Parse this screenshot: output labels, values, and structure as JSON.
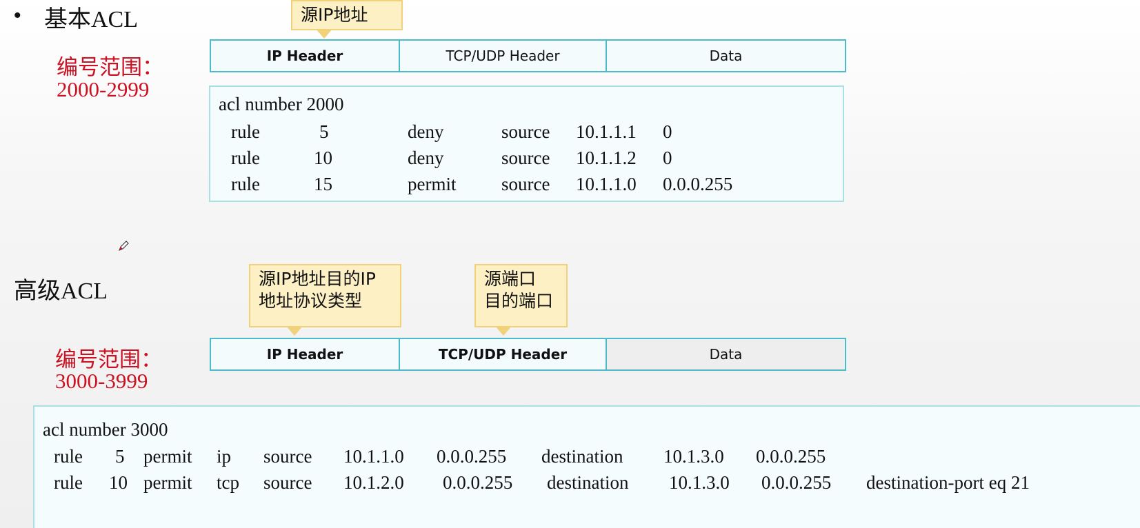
{
  "basic": {
    "bullet": "•",
    "title": "基本ACL",
    "range_label": "编号范围：",
    "range_value": "2000-2999",
    "callout": "源IP地址",
    "header_cells": [
      "IP Header",
      "TCP/UDP Header",
      "Data"
    ],
    "code_title": "acl number 2000",
    "rules": [
      [
        "rule",
        "5",
        "deny",
        "source",
        "10.1.1.1",
        "0"
      ],
      [
        "rule",
        "10",
        "deny",
        "source",
        "10.1.1.2",
        "0"
      ],
      [
        "rule",
        "15",
        "permit",
        "source",
        "10.1.1.0",
        "0.0.0.255"
      ]
    ]
  },
  "advanced": {
    "title": "高级ACL",
    "range_label": "编号范围：",
    "range_value": "3000-3999",
    "callout_ip_line1": "源IP地址目的IP",
    "callout_ip_line2": "地址协议类型",
    "callout_port_line1": "源端口",
    "callout_port_line2": "目的端口",
    "header_cells": [
      "IP Header",
      "TCP/UDP Header",
      "Data"
    ],
    "code_title": "acl number 3000",
    "rules": [
      [
        "rule",
        "5",
        "permit",
        "ip",
        "source",
        "10.1.1.0",
        "0.0.0.255",
        "destination",
        "10.1.3.0",
        "0.0.0.255",
        ""
      ],
      [
        "rule",
        "10",
        "permit",
        "tcp",
        "source",
        "10.1.2.0",
        "0.0.0.255",
        "destination",
        "10.1.3.0",
        "0.0.0.255",
        "destination-port eq 21"
      ]
    ]
  },
  "icons": {
    "cursor": "pencil-cursor-icon"
  },
  "colors": {
    "range_red": "#cc1122",
    "table_border": "#4cbac8",
    "callout_fill": "#fdf0c4"
  }
}
